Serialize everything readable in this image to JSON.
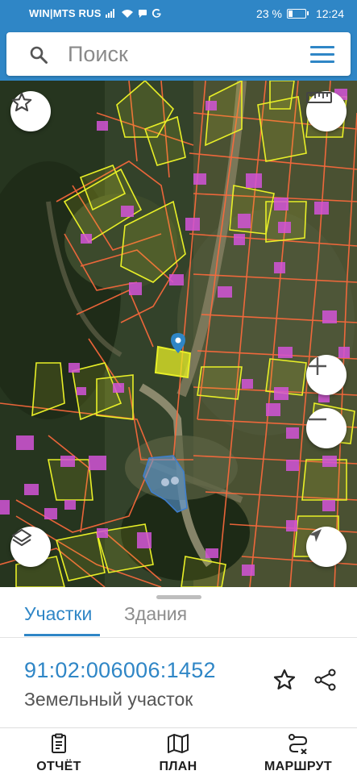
{
  "status_bar": {
    "carrier": "WIN|MTS RUS",
    "battery": "23 %",
    "time": "12:24"
  },
  "search": {
    "placeholder": "Поиск"
  },
  "map": {
    "selected_parcel_color": "#e8ef27",
    "parcel_border_color": "#ff6a3c",
    "building_color": "#d354d8",
    "pin_color": "#2f86c6"
  },
  "sheet": {
    "tabs": [
      {
        "label": "Участки",
        "active": true
      },
      {
        "label": "Здания",
        "active": false
      }
    ],
    "cadastral_number": "91:02:006006:1452",
    "parcel_type": "Земельный участок"
  },
  "bottom_nav": {
    "items": [
      {
        "label": "ОТЧЁТ",
        "icon": "report-icon"
      },
      {
        "label": "ПЛАН",
        "icon": "map-icon"
      },
      {
        "label": "МАРШРУТ",
        "icon": "route-icon"
      }
    ]
  }
}
